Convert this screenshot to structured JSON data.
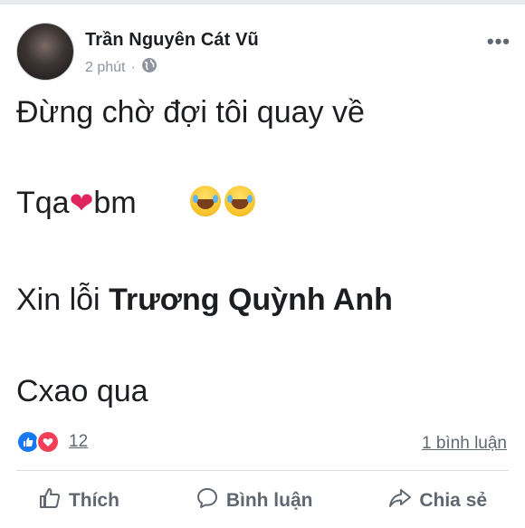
{
  "post": {
    "author_name": "Trần Nguyên Cát Vũ",
    "timestamp": "2 phút",
    "separator": "·",
    "privacy_icon": "globe-icon",
    "more_label": "•••",
    "lines": {
      "line1": "Đừng chờ đợi tôi quay về",
      "line2_start": "Tqa",
      "line2_heart": "❤",
      "line2_end": "bm",
      "line3_start": "Xin lỗi ",
      "line3_bold": "Trương Quỳnh Anh",
      "line4": "Cxao qua"
    },
    "emoji_icons": [
      "joy-emoji-icon",
      "joy-emoji-icon"
    ]
  },
  "stats": {
    "reaction_count": "12",
    "comment_count_label": "1 bình luận"
  },
  "actions": {
    "like": "Thích",
    "comment": "Bình luận",
    "share": "Chia sẻ"
  },
  "colors": {
    "like_blue": "#1877f2",
    "love_red": "#f33e58",
    "text_secondary": "#606770"
  }
}
